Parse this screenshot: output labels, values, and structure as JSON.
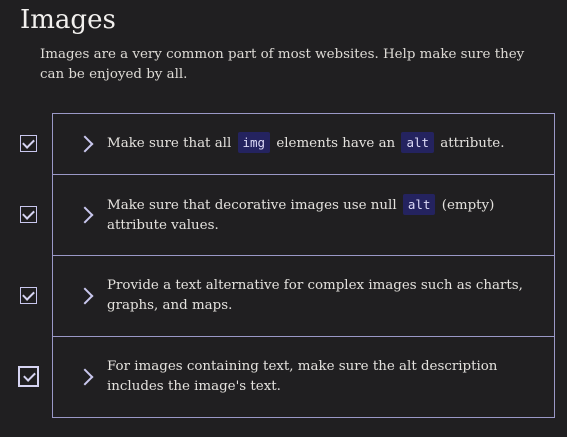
{
  "section": {
    "title": "Images",
    "intro": "Images are a very common part of most websites. Help make sure they can be enjoyed by all."
  },
  "checklist": {
    "items": [
      {
        "checked": true,
        "parts": [
          "Make sure that all ",
          "img",
          " elements have an ",
          "alt",
          " attribute."
        ]
      },
      {
        "checked": true,
        "parts": [
          "Make sure that decorative images use null ",
          "alt",
          " (empty) attribute values."
        ]
      },
      {
        "checked": true,
        "text": "Provide a text alternative for complex images such as charts, graphs, and maps."
      },
      {
        "checked": true,
        "text": "For images containing text, make sure the alt description includes the image's text."
      }
    ]
  },
  "icons": {
    "expand": "chevron-right-icon",
    "check": "checkmark-icon"
  },
  "colors": {
    "background": "#201f21",
    "border": "#9a98c7",
    "code_background": "#24235f",
    "text": "#e4e2de"
  }
}
